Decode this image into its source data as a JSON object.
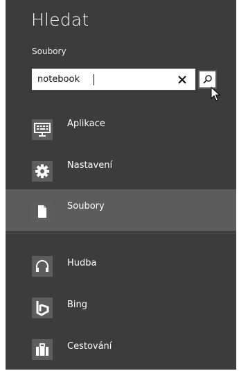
{
  "search": {
    "title": "Hledat",
    "scope": "Soubory",
    "query": "notebook",
    "clear_glyph": "✕",
    "submit_icon": "search-icon"
  },
  "apps": [
    {
      "label": "Aplikace",
      "icon": "keyboard-icon",
      "selected": false
    },
    {
      "label": "Nastavení",
      "icon": "gear-icon",
      "selected": false
    },
    {
      "label": "Soubory",
      "icon": "document-icon",
      "selected": true
    },
    {
      "label": "Hudba",
      "icon": "headphones-icon",
      "selected": false
    },
    {
      "label": "Bing",
      "icon": "bing-icon",
      "selected": false
    },
    {
      "label": "Cestování",
      "icon": "suitcase-icon",
      "selected": false
    }
  ],
  "colors": {
    "pane_bg": "#3c3c3c",
    "selected_bg": "#5c5c5c",
    "tile_bg": "#5d5d5d",
    "text": "#ffffff"
  }
}
